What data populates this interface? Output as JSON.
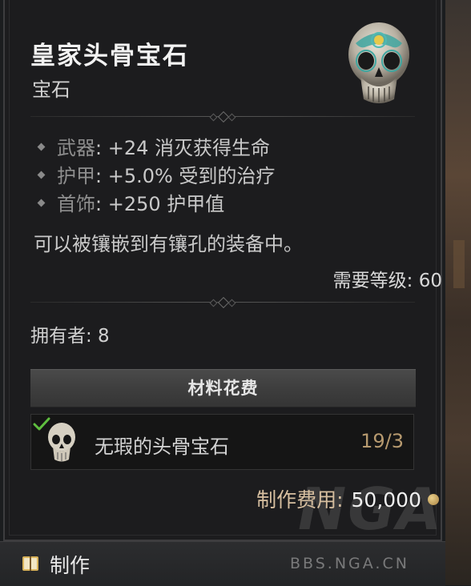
{
  "item": {
    "name": "皇家头骨宝石",
    "type": "宝石",
    "affixes": [
      {
        "slot": "武器",
        "effect": ": +24 消灭获得生命"
      },
      {
        "slot": "护甲",
        "effect": ": +5.0% 受到的治疗"
      },
      {
        "slot": "首饰",
        "effect": ": +250 护甲值"
      }
    ],
    "description": "可以被镶嵌到有镶孔的装备中。",
    "level_requirement": "需要等级: 60",
    "owned": "拥有者: 8"
  },
  "materials": {
    "header": "材料花费",
    "items": [
      {
        "name": "无瑕的头骨宝石",
        "count": "19/3"
      }
    ]
  },
  "cost": {
    "label": "制作费用:",
    "value": "50,000"
  },
  "footer": {
    "craft_label": "制作"
  },
  "watermark": {
    "logo": "NGA",
    "site": "BBS.NGA.CN"
  },
  "colors": {
    "panel_bg": "#1c1c1e",
    "material_count": "#b79a6f",
    "cost_label": "#d7bfa0",
    "check": "#5fbf3f"
  }
}
